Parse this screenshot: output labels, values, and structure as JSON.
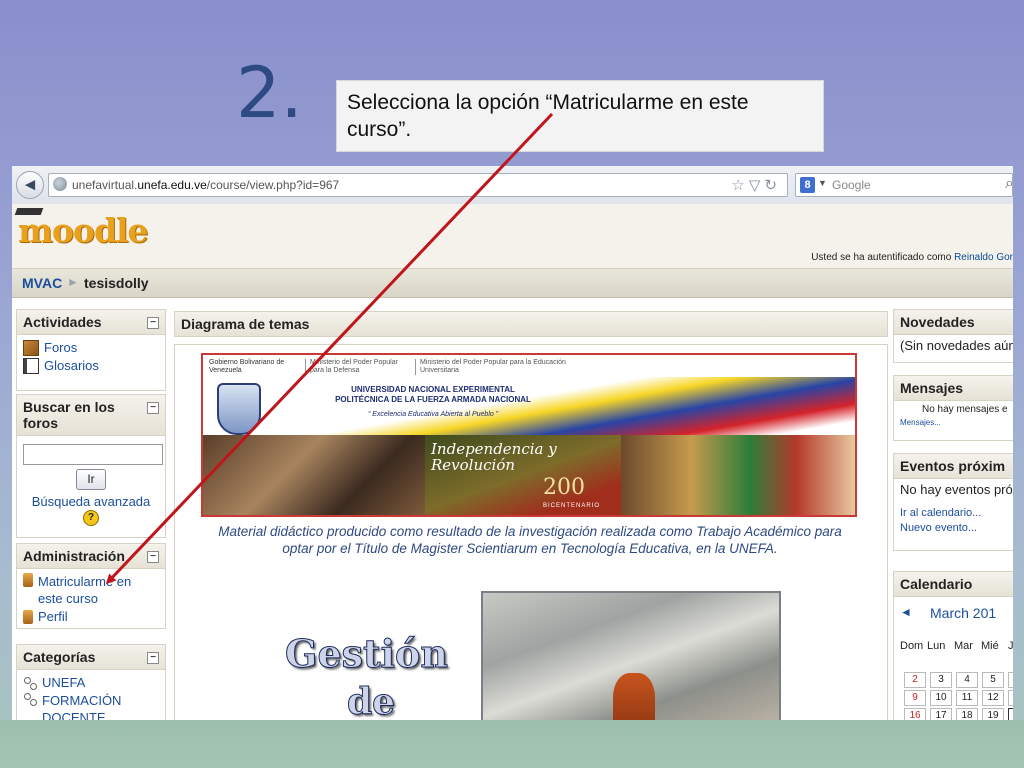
{
  "slide": {
    "step_number": "2.",
    "instruction": "Selecciona la opción “Matricularme en este curso”."
  },
  "browser": {
    "url_host_prefix": "unefavirtual.",
    "url_host_domain": "unefa.edu.ve",
    "url_path": "/course/view.php?id=967",
    "search_placeholder": "Google",
    "search_engine_icon": "8"
  },
  "moodle": {
    "logo_text": "moodle",
    "login_text": "Usted se ha autentificado como",
    "login_user": "Reinaldo Gor",
    "breadcrumb": {
      "root": "MVAC",
      "separator": "►",
      "current": "tesisdolly"
    }
  },
  "left_blocks": {
    "actividades": {
      "title": "Actividades",
      "items": [
        "Foros",
        "Glosarios"
      ]
    },
    "buscar": {
      "title": "Buscar en los foros",
      "button": "Ir",
      "advanced": "Búsqueda avanzada"
    },
    "administracion": {
      "title": "Administración",
      "items": [
        "Matricularme en este curso",
        "Perfil"
      ]
    },
    "categorias": {
      "title": "Categorías",
      "items": [
        "UNEFA",
        "FORMACIÓN DOCENTE"
      ]
    }
  },
  "main": {
    "header": "Diagrama de temas",
    "banner": {
      "gov_label": "Gobierno Bolivariano de Venezuela",
      "ministry_defense": "Ministerio del Poder Popular para la Defensa",
      "ministry_education": "Ministerio del Poder Popular para la Educación Universitaria",
      "university": "UNIVERSIDAD NACIONAL EXPERIMENTAL POLITÉCNICA DE LA FUERZA ARMADA NACIONAL",
      "motto": "“ Excelencia Educativa Abierta al Pueblo ”",
      "campaign": "Independencia y Revolución",
      "bicentennial": "200",
      "bicentennial_label": "BICENTENARIO"
    },
    "description": "Material didáctico producido como resultado de la investigación realizada como Trabajo Académico para optar por el Título de Magister Scientiarum en Tecnología Educativa, en la UNEFA.",
    "title_art_line1": "Gestión",
    "title_art_line2": "de"
  },
  "right_blocks": {
    "novedades": {
      "title": "Novedades",
      "text": "(Sin novedades aún"
    },
    "mensajes": {
      "title": "Mensajes",
      "text": "No hay mensajes e",
      "link": "Mensajes..."
    },
    "eventos": {
      "title": "Eventos próxim",
      "text": "No hay eventos pró",
      "links": [
        "Ir al calendario...",
        "Nuevo evento..."
      ]
    },
    "calendario": {
      "title": "Calendario",
      "prev": "◄",
      "month": "March 201",
      "weekdays": [
        "Dom",
        "Lun",
        "Mar",
        "Mié",
        "J"
      ],
      "rows": [
        [
          "2",
          "3",
          "4",
          "5",
          ""
        ],
        [
          "9",
          "10",
          "11",
          "12",
          ""
        ],
        [
          "16",
          "17",
          "18",
          "19",
          ""
        ]
      ]
    }
  }
}
